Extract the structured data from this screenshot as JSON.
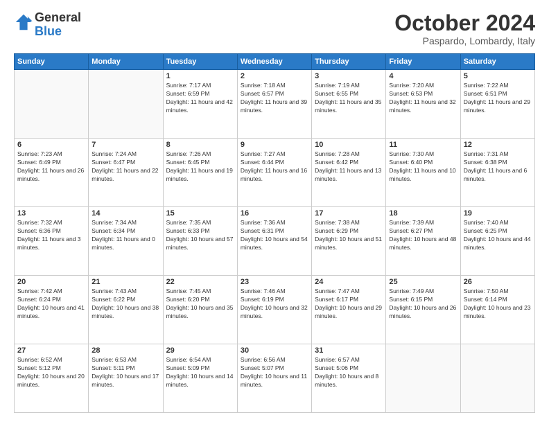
{
  "logo": {
    "line1": "General",
    "line2": "Blue"
  },
  "title": "October 2024",
  "location": "Paspardo, Lombardy, Italy",
  "header_days": [
    "Sunday",
    "Monday",
    "Tuesday",
    "Wednesday",
    "Thursday",
    "Friday",
    "Saturday"
  ],
  "weeks": [
    [
      {
        "day": "",
        "sunrise": "",
        "sunset": "",
        "daylight": ""
      },
      {
        "day": "",
        "sunrise": "",
        "sunset": "",
        "daylight": ""
      },
      {
        "day": "1",
        "sunrise": "Sunrise: 7:17 AM",
        "sunset": "Sunset: 6:59 PM",
        "daylight": "Daylight: 11 hours and 42 minutes."
      },
      {
        "day": "2",
        "sunrise": "Sunrise: 7:18 AM",
        "sunset": "Sunset: 6:57 PM",
        "daylight": "Daylight: 11 hours and 39 minutes."
      },
      {
        "day": "3",
        "sunrise": "Sunrise: 7:19 AM",
        "sunset": "Sunset: 6:55 PM",
        "daylight": "Daylight: 11 hours and 35 minutes."
      },
      {
        "day": "4",
        "sunrise": "Sunrise: 7:20 AM",
        "sunset": "Sunset: 6:53 PM",
        "daylight": "Daylight: 11 hours and 32 minutes."
      },
      {
        "day": "5",
        "sunrise": "Sunrise: 7:22 AM",
        "sunset": "Sunset: 6:51 PM",
        "daylight": "Daylight: 11 hours and 29 minutes."
      }
    ],
    [
      {
        "day": "6",
        "sunrise": "Sunrise: 7:23 AM",
        "sunset": "Sunset: 6:49 PM",
        "daylight": "Daylight: 11 hours and 26 minutes."
      },
      {
        "day": "7",
        "sunrise": "Sunrise: 7:24 AM",
        "sunset": "Sunset: 6:47 PM",
        "daylight": "Daylight: 11 hours and 22 minutes."
      },
      {
        "day": "8",
        "sunrise": "Sunrise: 7:26 AM",
        "sunset": "Sunset: 6:45 PM",
        "daylight": "Daylight: 11 hours and 19 minutes."
      },
      {
        "day": "9",
        "sunrise": "Sunrise: 7:27 AM",
        "sunset": "Sunset: 6:44 PM",
        "daylight": "Daylight: 11 hours and 16 minutes."
      },
      {
        "day": "10",
        "sunrise": "Sunrise: 7:28 AM",
        "sunset": "Sunset: 6:42 PM",
        "daylight": "Daylight: 11 hours and 13 minutes."
      },
      {
        "day": "11",
        "sunrise": "Sunrise: 7:30 AM",
        "sunset": "Sunset: 6:40 PM",
        "daylight": "Daylight: 11 hours and 10 minutes."
      },
      {
        "day": "12",
        "sunrise": "Sunrise: 7:31 AM",
        "sunset": "Sunset: 6:38 PM",
        "daylight": "Daylight: 11 hours and 6 minutes."
      }
    ],
    [
      {
        "day": "13",
        "sunrise": "Sunrise: 7:32 AM",
        "sunset": "Sunset: 6:36 PM",
        "daylight": "Daylight: 11 hours and 3 minutes."
      },
      {
        "day": "14",
        "sunrise": "Sunrise: 7:34 AM",
        "sunset": "Sunset: 6:34 PM",
        "daylight": "Daylight: 11 hours and 0 minutes."
      },
      {
        "day": "15",
        "sunrise": "Sunrise: 7:35 AM",
        "sunset": "Sunset: 6:33 PM",
        "daylight": "Daylight: 10 hours and 57 minutes."
      },
      {
        "day": "16",
        "sunrise": "Sunrise: 7:36 AM",
        "sunset": "Sunset: 6:31 PM",
        "daylight": "Daylight: 10 hours and 54 minutes."
      },
      {
        "day": "17",
        "sunrise": "Sunrise: 7:38 AM",
        "sunset": "Sunset: 6:29 PM",
        "daylight": "Daylight: 10 hours and 51 minutes."
      },
      {
        "day": "18",
        "sunrise": "Sunrise: 7:39 AM",
        "sunset": "Sunset: 6:27 PM",
        "daylight": "Daylight: 10 hours and 48 minutes."
      },
      {
        "day": "19",
        "sunrise": "Sunrise: 7:40 AM",
        "sunset": "Sunset: 6:25 PM",
        "daylight": "Daylight: 10 hours and 44 minutes."
      }
    ],
    [
      {
        "day": "20",
        "sunrise": "Sunrise: 7:42 AM",
        "sunset": "Sunset: 6:24 PM",
        "daylight": "Daylight: 10 hours and 41 minutes."
      },
      {
        "day": "21",
        "sunrise": "Sunrise: 7:43 AM",
        "sunset": "Sunset: 6:22 PM",
        "daylight": "Daylight: 10 hours and 38 minutes."
      },
      {
        "day": "22",
        "sunrise": "Sunrise: 7:45 AM",
        "sunset": "Sunset: 6:20 PM",
        "daylight": "Daylight: 10 hours and 35 minutes."
      },
      {
        "day": "23",
        "sunrise": "Sunrise: 7:46 AM",
        "sunset": "Sunset: 6:19 PM",
        "daylight": "Daylight: 10 hours and 32 minutes."
      },
      {
        "day": "24",
        "sunrise": "Sunrise: 7:47 AM",
        "sunset": "Sunset: 6:17 PM",
        "daylight": "Daylight: 10 hours and 29 minutes."
      },
      {
        "day": "25",
        "sunrise": "Sunrise: 7:49 AM",
        "sunset": "Sunset: 6:15 PM",
        "daylight": "Daylight: 10 hours and 26 minutes."
      },
      {
        "day": "26",
        "sunrise": "Sunrise: 7:50 AM",
        "sunset": "Sunset: 6:14 PM",
        "daylight": "Daylight: 10 hours and 23 minutes."
      }
    ],
    [
      {
        "day": "27",
        "sunrise": "Sunrise: 6:52 AM",
        "sunset": "Sunset: 5:12 PM",
        "daylight": "Daylight: 10 hours and 20 minutes."
      },
      {
        "day": "28",
        "sunrise": "Sunrise: 6:53 AM",
        "sunset": "Sunset: 5:11 PM",
        "daylight": "Daylight: 10 hours and 17 minutes."
      },
      {
        "day": "29",
        "sunrise": "Sunrise: 6:54 AM",
        "sunset": "Sunset: 5:09 PM",
        "daylight": "Daylight: 10 hours and 14 minutes."
      },
      {
        "day": "30",
        "sunrise": "Sunrise: 6:56 AM",
        "sunset": "Sunset: 5:07 PM",
        "daylight": "Daylight: 10 hours and 11 minutes."
      },
      {
        "day": "31",
        "sunrise": "Sunrise: 6:57 AM",
        "sunset": "Sunset: 5:06 PM",
        "daylight": "Daylight: 10 hours and 8 minutes."
      },
      {
        "day": "",
        "sunrise": "",
        "sunset": "",
        "daylight": ""
      },
      {
        "day": "",
        "sunrise": "",
        "sunset": "",
        "daylight": ""
      }
    ]
  ]
}
